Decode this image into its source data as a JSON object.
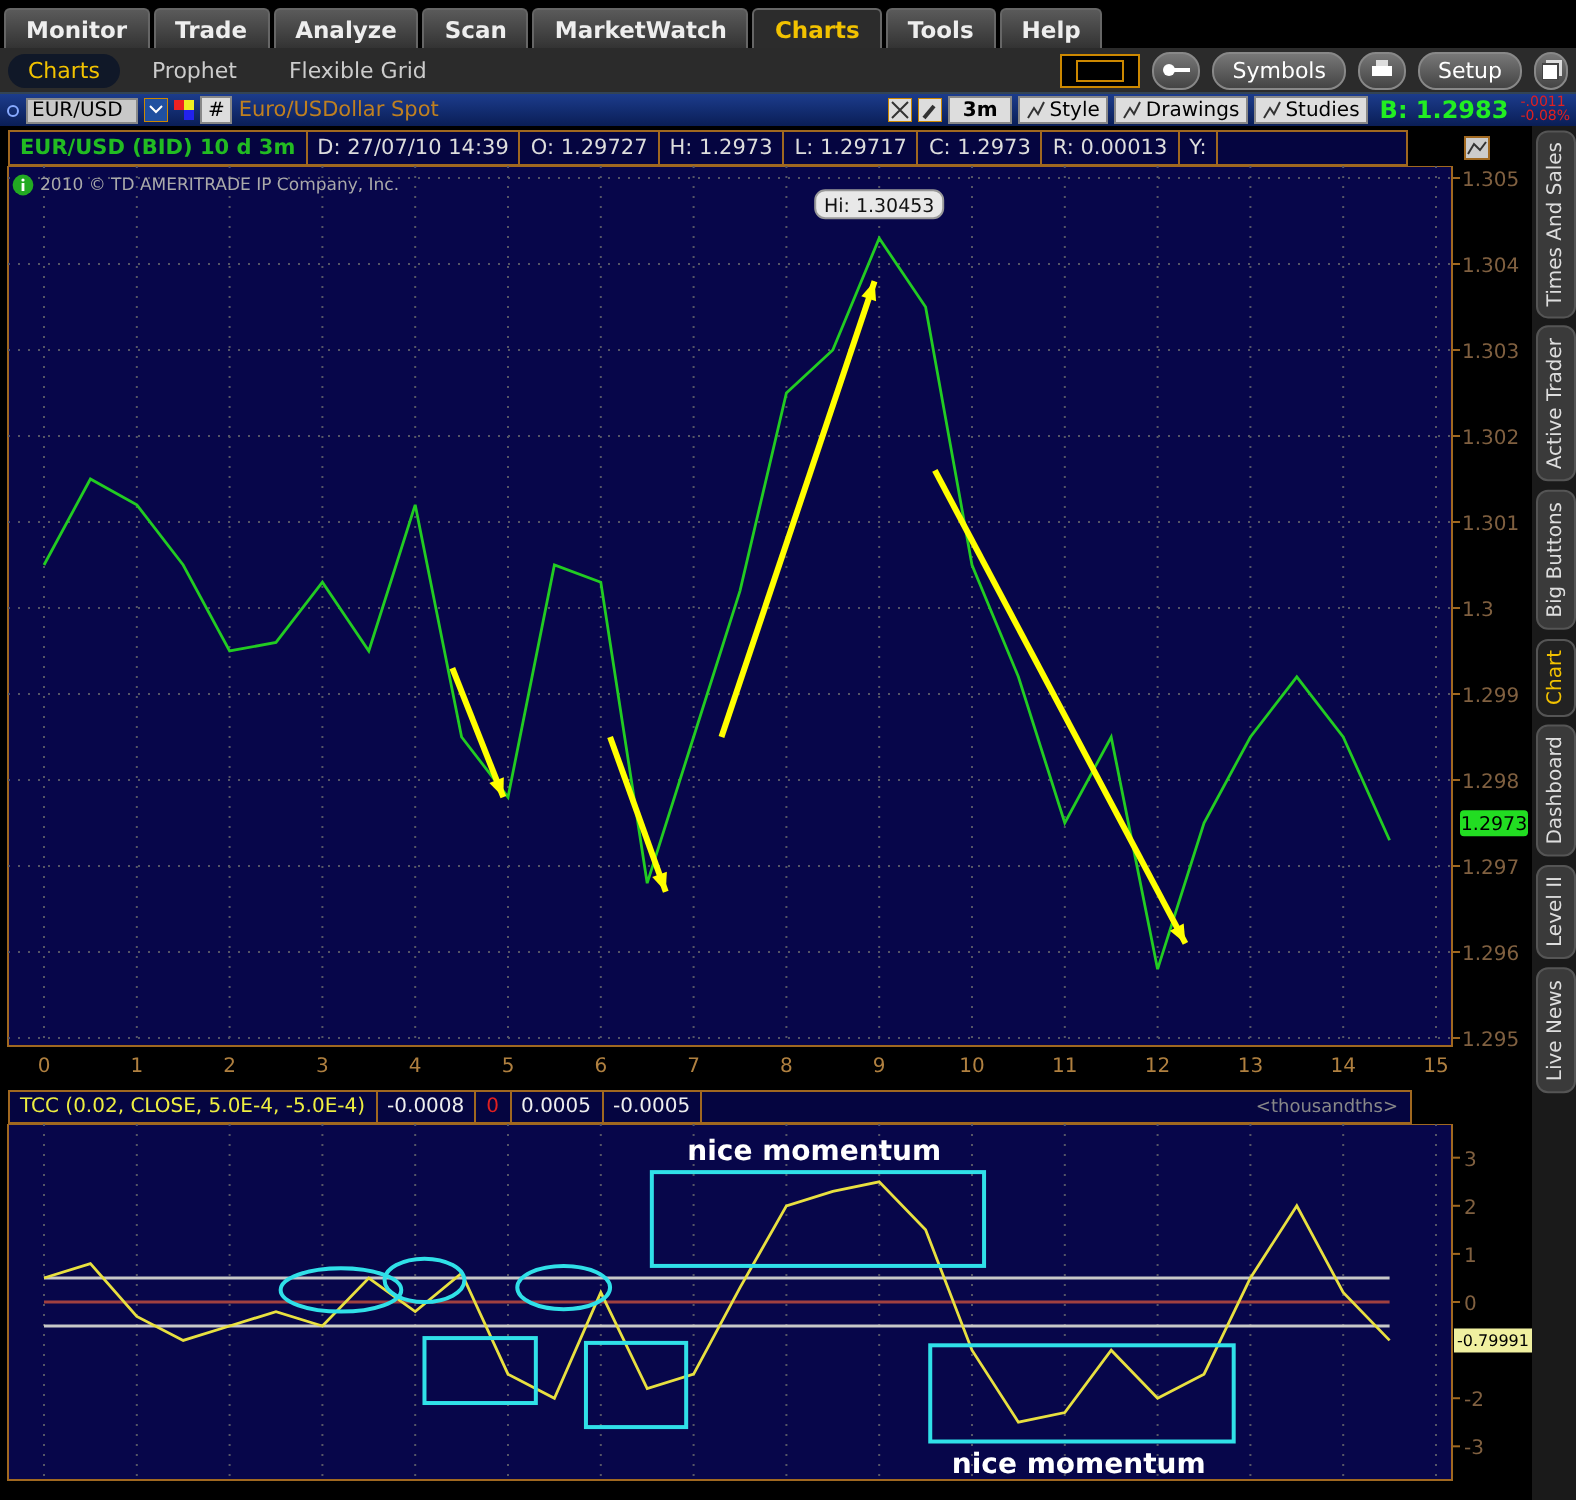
{
  "main_tabs": [
    {
      "label": "Monitor",
      "selected": false
    },
    {
      "label": "Trade",
      "selected": false
    },
    {
      "label": "Analyze",
      "selected": false
    },
    {
      "label": "Scan",
      "selected": false
    },
    {
      "label": "MarketWatch",
      "selected": false
    },
    {
      "label": "Charts",
      "selected": true
    },
    {
      "label": "Tools",
      "selected": false
    },
    {
      "label": "Help",
      "selected": false
    }
  ],
  "sub_tabs": [
    {
      "label": "Charts",
      "selected": true
    },
    {
      "label": "Prophet",
      "selected": false
    },
    {
      "label": "Flexible Grid",
      "selected": false
    }
  ],
  "top_buttons": [
    "Symbols",
    "Setup"
  ],
  "toolbar": {
    "symbol": "EUR/USD",
    "description": "Euro/USDollar Spot",
    "symbol_button": "#",
    "aggregation": "3m",
    "buttons": [
      "Style",
      "Drawings",
      "Studies"
    ],
    "bid": "B: 1.2983",
    "change": "-.0011",
    "change_percent": "-0.08%"
  },
  "info_bar": [
    "EUR/USD (BID) 10 d 3m",
    "D: 27/07/10 14:39",
    "O: 1.29727",
    "H: 1.2973",
    "L: 1.29717",
    "C: 1.2973",
    "R: 0.00013",
    "Y:"
  ],
  "copyright": "2010 © TD AMERITRADE IP Company, Inc.",
  "price_chart": {
    "current_price": "1.2973",
    "chart_data": {
      "type": "line",
      "x": [
        0,
        0.5,
        1,
        1.5,
        2,
        2.5,
        3,
        3.5,
        4,
        4.5,
        5,
        5.5,
        6,
        6.5,
        7,
        7.5,
        8,
        8.5,
        9,
        9.5,
        10,
        10.5,
        11,
        11.5,
        12,
        12.5,
        13,
        13.5,
        14,
        14.5
      ],
      "series": [
        {
          "color": "#22cc22",
          "values": [
            1.3005,
            1.3015,
            1.3012,
            1.3005,
            1.2995,
            1.2996,
            1.3003,
            1.2995,
            1.3012,
            1.2985,
            1.2978,
            1.3005,
            1.3003,
            1.2968,
            1.2985,
            1.3002,
            1.3025,
            1.303,
            1.3043,
            1.3035,
            1.3005,
            1.2992,
            1.2975,
            1.2985,
            1.2958,
            1.2975,
            1.2985,
            1.2992,
            1.2985,
            1.2973
          ]
        }
      ],
      "xlim": [
        0,
        15
      ],
      "ylim": [
        1.295,
        1.305
      ],
      "xticks": [
        0,
        1,
        2,
        3,
        4,
        5,
        6,
        7,
        8,
        9,
        10,
        11,
        12,
        13,
        14,
        15
      ],
      "yticks": [
        1.305,
        1.304,
        1.303,
        1.302,
        1.301,
        1.3,
        1.299,
        1.298,
        1.297,
        1.296,
        1.295
      ],
      "grid": true,
      "annotations": [
        "Hi: 1.30453"
      ]
    }
  },
  "indicator": {
    "title": "TCC (0.02, CLOSE, 5.0E-4, -5.0E-4)",
    "values": [
      "-0.0008",
      "0",
      "0.0005",
      "-0.0005"
    ],
    "units": "<thousandths>",
    "current_value": "-0.79991",
    "chart_data": {
      "type": "line",
      "x": [
        0,
        0.5,
        1,
        1.5,
        2,
        2.5,
        3,
        3.5,
        4,
        4.5,
        5,
        5.5,
        6,
        6.5,
        7,
        7.5,
        8,
        8.5,
        9,
        9.5,
        10,
        10.5,
        11,
        11.5,
        12,
        12.5,
        13,
        13.5,
        14,
        14.5
      ],
      "series": [
        {
          "color": "#c8c8c8",
          "values": [
            0.5,
            0.5,
            0.5,
            0.5,
            0.5,
            0.5,
            0.5,
            0.5,
            0.5,
            0.5,
            0.5,
            0.5,
            0.5,
            0.5,
            0.5,
            0.5,
            0.5,
            0.5,
            0.5,
            0.5,
            0.5,
            0.5,
            0.5,
            0.5,
            0.5,
            0.5,
            0.5,
            0.5,
            0.5,
            0.5
          ]
        },
        {
          "color": "#a04040",
          "values": [
            0,
            0,
            0,
            0,
            0,
            0,
            0,
            0,
            0,
            0,
            0,
            0,
            0,
            0,
            0,
            0,
            0,
            0,
            0,
            0,
            0,
            0,
            0,
            0,
            0,
            0,
            0,
            0,
            0,
            0
          ]
        },
        {
          "color": "#c8c8c8",
          "values": [
            -0.5,
            -0.5,
            -0.5,
            -0.5,
            -0.5,
            -0.5,
            -0.5,
            -0.5,
            -0.5,
            -0.5,
            -0.5,
            -0.5,
            -0.5,
            -0.5,
            -0.5,
            -0.5,
            -0.5,
            -0.5,
            -0.5,
            -0.5,
            -0.5,
            -0.5,
            -0.5,
            -0.5,
            -0.5,
            -0.5,
            -0.5,
            -0.5,
            -0.5,
            -0.5
          ]
        },
        {
          "color": "#e8e040",
          "values": [
            0.5,
            0.8,
            -0.3,
            -0.8,
            -0.5,
            -0.2,
            -0.5,
            0.5,
            -0.2,
            0.6,
            -1.5,
            -2,
            0.2,
            -1.8,
            -1.5,
            0.3,
            2,
            2.3,
            2.5,
            1.5,
            -1,
            -2.5,
            -2.3,
            -1,
            -2,
            -1.5,
            0.5,
            2,
            0.2,
            -0.8
          ]
        }
      ],
      "xlim": [
        0,
        15
      ],
      "ylim": [
        -3.7,
        3.7
      ],
      "yticks": [
        3,
        2,
        1,
        0,
        -2,
        -3
      ],
      "grid": true,
      "annotations": [
        "nice momentum",
        "nice momentum"
      ]
    }
  },
  "side_tabs": [
    {
      "label": "Times And Sales",
      "selected": false
    },
    {
      "label": "Active Trader",
      "selected": false
    },
    {
      "label": "Big Buttons",
      "selected": false
    },
    {
      "label": "Chart",
      "selected": true
    },
    {
      "label": "Dashboard",
      "selected": false
    },
    {
      "label": "Level II",
      "selected": false
    },
    {
      "label": "Live News",
      "selected": false
    }
  ]
}
